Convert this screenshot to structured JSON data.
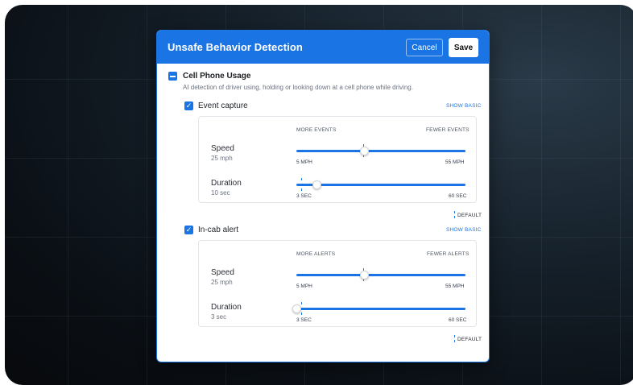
{
  "modal": {
    "title": "Unsafe Behavior Detection",
    "cancel_label": "Cancel",
    "save_label": "Save"
  },
  "section": {
    "title": "Cell Phone Usage",
    "description": "AI detection of driver using, holding or looking down at a cell phone while driving.",
    "checked": "partial"
  },
  "event_capture": {
    "label": "Event capture",
    "checked": true,
    "link": "SHOW BASIC",
    "col_left": "MORE EVENTS",
    "col_right": "FEWER EVENTS",
    "speed": {
      "label": "Speed",
      "value": "25 mph",
      "min": "5 MPH",
      "max": "55 MPH",
      "level": 0.4
    },
    "duration": {
      "label": "Duration",
      "value": "10 sec",
      "min": "3 SEC",
      "max": "60 SEC",
      "level": 0.12
    },
    "default_label": "DEFAULT"
  },
  "in_cab_alert": {
    "label": "In-cab alert",
    "checked": true,
    "link": "SHOW BASIC",
    "col_left": "MORE ALERTS",
    "col_right": "FEWER ALERTS",
    "speed": {
      "label": "Speed",
      "value": "25 mph",
      "min": "5 MPH",
      "max": "55 MPH",
      "level": 0.4
    },
    "duration": {
      "label": "Duration",
      "value": "3 sec",
      "min": "3 SEC",
      "max": "60 SEC",
      "level": 0.0
    },
    "default_label": "DEFAULT"
  },
  "colors": {
    "accent": "#1b74e4",
    "background": "#0b1016"
  }
}
